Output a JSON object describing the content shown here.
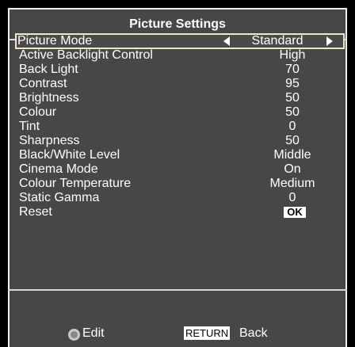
{
  "title": "Picture Settings",
  "items": [
    {
      "label": "Picture Mode",
      "value": "Standard"
    },
    {
      "label": "Active Backlight Control",
      "value": "High"
    },
    {
      "label": "Back Light",
      "value": "70"
    },
    {
      "label": "Contrast",
      "value": "95"
    },
    {
      "label": "Brightness",
      "value": "50"
    },
    {
      "label": "Colour",
      "value": "50"
    },
    {
      "label": "Tint",
      "value": "0"
    },
    {
      "label": "Sharpness",
      "value": "50"
    },
    {
      "label": "Black/White Level",
      "value": "Middle"
    },
    {
      "label": "Cinema Mode",
      "value": "On"
    },
    {
      "label": "Colour Temperature",
      "value": "Medium"
    },
    {
      "label": "Static Gamma",
      "value": "0"
    },
    {
      "label": "Reset",
      "value": "OK"
    }
  ],
  "footer": {
    "edit_label": "Edit",
    "return_key": "RETURN",
    "back_label": "Back"
  },
  "icons": {
    "edit": "dpad-icon",
    "left": "arrow-left-icon",
    "right": "arrow-right-icon"
  }
}
